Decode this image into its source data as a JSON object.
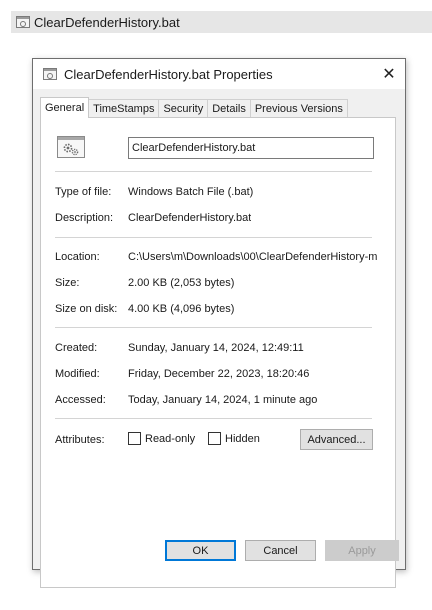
{
  "file_strip": {
    "icon": "bat-file-icon",
    "label": "ClearDefenderHistory.bat"
  },
  "dialog": {
    "title": "ClearDefenderHistory.bat Properties",
    "close_glyph": "✕",
    "tabs": [
      {
        "label": "General",
        "active": true
      },
      {
        "label": "TimeStamps",
        "active": false
      },
      {
        "label": "Security",
        "active": false
      },
      {
        "label": "Details",
        "active": false
      },
      {
        "label": "Previous Versions",
        "active": false
      }
    ],
    "general": {
      "file_icon": "batch-gear-icon",
      "file_name": "ClearDefenderHistory.bat",
      "type_label": "Type of file:",
      "type_value": "Windows Batch File (.bat)",
      "description_label": "Description:",
      "description_value": "ClearDefenderHistory.bat",
      "location_label": "Location:",
      "location_value": "C:\\Users\\m\\Downloads\\00\\ClearDefenderHistory-m",
      "size_label": "Size:",
      "size_value": "2.00 KB (2,053 bytes)",
      "size_on_disk_label": "Size on disk:",
      "size_on_disk_value": "4.00 KB (4,096 bytes)",
      "created_label": "Created:",
      "created_value": "Sunday, January 14, 2024, 12:49:11",
      "modified_label": "Modified:",
      "modified_value": "Friday, December 22, 2023, 18:20:46",
      "accessed_label": "Accessed:",
      "accessed_value": "Today, January 14, 2024, 1 minute ago",
      "attributes_label": "Attributes:",
      "readonly_label": "Read-only",
      "readonly_checked": false,
      "hidden_label": "Hidden",
      "hidden_checked": false,
      "advanced_label": "Advanced..."
    },
    "buttons": {
      "ok": "OK",
      "cancel": "Cancel",
      "apply": "Apply"
    }
  },
  "colors": {
    "accent": "#0078d7",
    "dialog_bg": "#f0f0f0",
    "panel_bg": "#ffffff",
    "strip_bg": "#e6e6e6"
  }
}
